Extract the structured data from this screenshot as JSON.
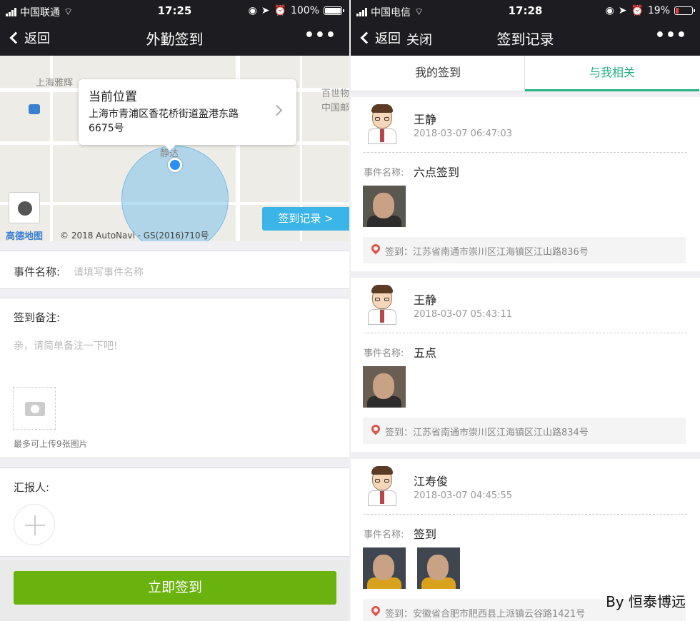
{
  "left": {
    "status": {
      "carrier": "中国联通",
      "time": "17:25",
      "battery": "100%"
    },
    "nav": {
      "back_label": "返回",
      "title": "外勤签到",
      "more": "•••"
    },
    "map": {
      "pois": [
        "上海雅辉",
        "百世物",
        "中国邮",
        "静达"
      ],
      "callout_title": "当前位置",
      "callout_address": "上海市青浦区香花桥街道盈港东路6675号",
      "records_button": "签到记录 >",
      "logo": "高德地图",
      "copyright": "© 2018 AutoNavi - GS(2016)710号"
    },
    "form": {
      "event_label": "事件名称:",
      "event_placeholder": "请填写事件名称",
      "remark_label": "签到备注:",
      "remark_placeholder": "亲，请简单备注一下吧!",
      "upload_hint": "最多可上传9张图片",
      "reporter_label": "汇报人:"
    },
    "submit_label": "立即签到"
  },
  "right": {
    "status": {
      "carrier": "中国电信",
      "time": "17:28",
      "battery": "19%"
    },
    "nav": {
      "back_label": "返回",
      "close_label": "关闭",
      "title": "签到记录",
      "more": "•••"
    },
    "tabs": [
      {
        "label": "我的签到",
        "active": false
      },
      {
        "label": "与我相关",
        "active": true
      }
    ],
    "event_prefix": "事件名称:",
    "sign_prefix": "签到：",
    "records": [
      {
        "name": "王静",
        "time": "2018-03-07 06:47:03",
        "event": "六点签到",
        "address": "江苏省南通市崇川区江海镇区江山路836号"
      },
      {
        "name": "王静",
        "time": "2018-03-07 05:43:11",
        "event": "五点",
        "address": "江苏省南通市崇川区江海镇区江山路834号"
      },
      {
        "name": "江寿俊",
        "time": "2018-03-07 04:45:55",
        "event": "签到",
        "address": "安徽省合肥市肥西县上派镇云谷路1421号"
      }
    ]
  },
  "watermark": "By 恒泰博远",
  "colors": {
    "accent_green": "#26b07f",
    "button_green": "#6ab20e",
    "map_blue": "#3bb4e8"
  }
}
